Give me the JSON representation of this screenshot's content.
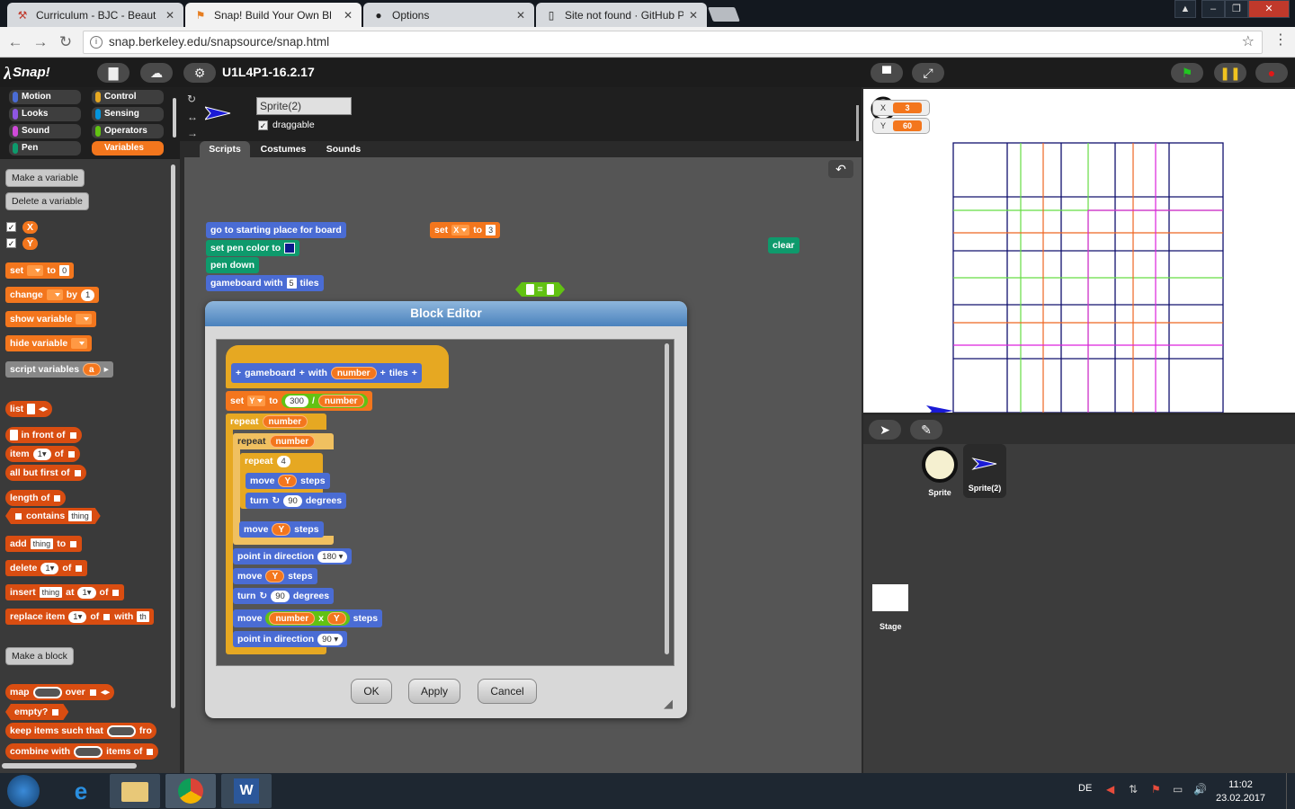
{
  "browser": {
    "tabs": [
      {
        "label": "Curriculum - BJC - Beaut",
        "icon": "bjc-icon"
      },
      {
        "label": "Snap! Build Your Own Bl",
        "icon": "snap-icon"
      },
      {
        "label": "Options",
        "icon": "github-icon"
      },
      {
        "label": "Site not found · GitHub P",
        "icon": "page-icon"
      }
    ],
    "url": "snap.berkeley.edu/snapsource/snap.html"
  },
  "snap": {
    "logo": "Snap!",
    "project_title": "U1L4P1-16.2.17",
    "categories": [
      "Motion",
      "Looks",
      "Sound",
      "Pen",
      "Control",
      "Sensing",
      "Operators",
      "Variables"
    ],
    "category_colors": {
      "Motion": "#4a6cd4",
      "Looks": "#8f56e3",
      "Sound": "#cf4ad9",
      "Pen": "#0e9a6c",
      "Control": "#e6a822",
      "Sensing": "#0494dc",
      "Operators": "#62c213",
      "Variables": "#f3761d"
    },
    "selected_category": "Variables"
  },
  "palette": {
    "make_variable": "Make a variable",
    "delete_variable": "Delete a variable",
    "vars": [
      "X",
      "Y"
    ],
    "set": "set",
    "to": "to",
    "zero": "0",
    "change": "change",
    "by": "by",
    "one": "1",
    "show_variable": "show variable",
    "hide_variable": "hide variable",
    "script_variables": "script variables",
    "a": "a",
    "list": "list",
    "in_front_of": "in front of",
    "item": "item",
    "of": "of",
    "all_but_first_of": "all but first of",
    "length_of": "length of",
    "contains": "contains",
    "thing": "thing",
    "add": "add",
    "delete": "delete",
    "insert": "insert",
    "at": "at",
    "replace_item": "replace item",
    "with": "with",
    "with_tail": "th",
    "make_block": "Make a block",
    "map": "map",
    "over": "over",
    "empty": "empty?",
    "keep_items": "keep items such that",
    "from_tail": "fro",
    "combine_with": "combine with",
    "items_of": "items of"
  },
  "sprite": {
    "name": "Sprite(2)",
    "draggable": "draggable",
    "tabs": [
      "Scripts",
      "Costumes",
      "Sounds"
    ]
  },
  "scripts": {
    "go_to_start": "go to starting place for board",
    "set_pen_color": "set pen color to",
    "pen_down": "pen down",
    "gameboard_with": "gameboard with",
    "gameboard_n": "5",
    "tiles": "tiles",
    "set_x_var": "X",
    "set_x_val": "3",
    "clear": "clear",
    "equals": "="
  },
  "editor": {
    "title": "Block Editor",
    "hat_gameboard": "gameboard",
    "hat_with": "with",
    "hat_param": "number",
    "hat_tiles": "tiles",
    "set_var": "Y",
    "num_300": "300",
    "div": "/",
    "param": "number",
    "repeat": "repeat",
    "repeat_4": "4",
    "move": "move",
    "steps": "steps",
    "turn": "turn",
    "deg_90": "90",
    "degrees": "degrees",
    "point_in_direction": "point in direction",
    "dir_180": "180",
    "dir_90": "90",
    "times": "x",
    "buttons": {
      "ok": "OK",
      "apply": "Apply",
      "cancel": "Cancel"
    }
  },
  "stage": {
    "watchers": [
      {
        "label": "X",
        "value": "3"
      },
      {
        "label": "Y",
        "value": "60"
      }
    ]
  },
  "corral": {
    "sprites": [
      "Sprite",
      "Sprite(2)"
    ],
    "stage_label": "Stage"
  },
  "taskbar": {
    "lang": "DE",
    "time": "11:02",
    "date": "23.02.2017"
  }
}
